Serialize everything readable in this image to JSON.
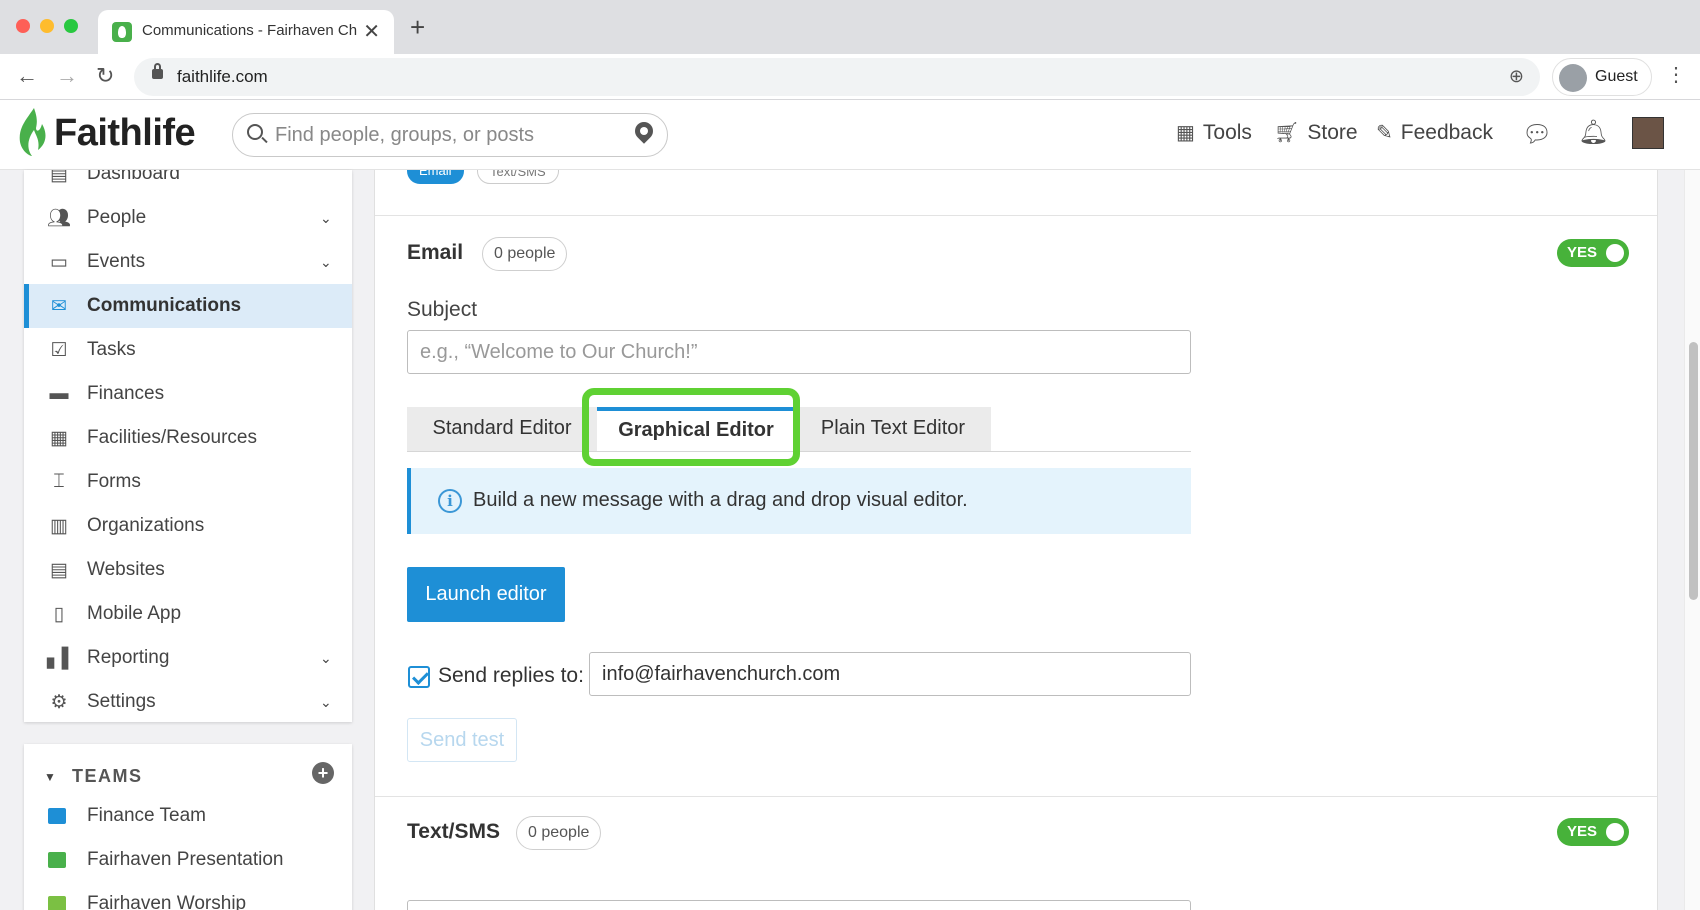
{
  "browser": {
    "tab_title": "Communications - Fairhaven Church",
    "url": "faithlife.com",
    "profile_label": "Guest",
    "icons": [
      "back-icon",
      "forward-icon",
      "reload-icon",
      "lock-icon",
      "zoom-icon",
      "menu-icon"
    ]
  },
  "header": {
    "logo": "Faithlife",
    "search_placeholder": "Find people, groups, or posts",
    "nav": [
      {
        "label": "Tools",
        "icon": "grid-icon"
      },
      {
        "label": "Store",
        "icon": "cart-icon"
      },
      {
        "label": "Feedback",
        "icon": "feedback-icon"
      }
    ]
  },
  "sidebar": {
    "items": [
      {
        "label": "Dashboard",
        "icon": "dashboard-icon",
        "chevron": false
      },
      {
        "label": "People",
        "icon": "people-icon",
        "chevron": true
      },
      {
        "label": "Events",
        "icon": "calendar-icon",
        "chevron": true
      },
      {
        "label": "Communications",
        "icon": "envelope-icon",
        "chevron": false,
        "active": true
      },
      {
        "label": "Tasks",
        "icon": "clipboard-icon",
        "chevron": false
      },
      {
        "label": "Finances",
        "icon": "credit-card-icon",
        "chevron": false
      },
      {
        "label": "Facilities/Resources",
        "icon": "building-icon",
        "chevron": false
      },
      {
        "label": "Forms",
        "icon": "form-icon",
        "chevron": false
      },
      {
        "label": "Organizations",
        "icon": "organization-icon",
        "chevron": false
      },
      {
        "label": "Websites",
        "icon": "website-icon",
        "chevron": false
      },
      {
        "label": "Mobile App",
        "icon": "mobile-icon",
        "chevron": false
      },
      {
        "label": "Reporting",
        "icon": "bar-chart-icon",
        "chevron": true
      },
      {
        "label": "Settings",
        "icon": "gear-icon",
        "chevron": true
      }
    ]
  },
  "teams": {
    "heading": "TEAMS",
    "items": [
      {
        "label": "Finance Team",
        "color": "#1e8fd6"
      },
      {
        "label": "Fairhaven Presentation",
        "color": "#49b04b"
      },
      {
        "label": "Fairhaven Worship",
        "color": "#7bc043"
      }
    ]
  },
  "main": {
    "top_pills": [
      "Email",
      "Text/SMS"
    ],
    "email": {
      "title": "Email",
      "people_count": "0 people",
      "toggle_label": "YES",
      "subject_label": "Subject",
      "subject_placeholder": "e.g., “Welcome to Our Church!”",
      "editor_tabs": [
        "Standard Editor",
        "Graphical Editor",
        "Plain Text Editor"
      ],
      "active_tab": "Graphical Editor",
      "info_text": "Build a new message with a drag and drop visual editor.",
      "launch_label": "Launch editor",
      "replies_label": "Send replies to:",
      "replies_checked": true,
      "replies_value": "info@fairhavenchurch.com",
      "send_test_label": "Send test"
    },
    "sms": {
      "title": "Text/SMS",
      "people_count": "0 people",
      "toggle_label": "YES"
    }
  },
  "colors": {
    "accent": "#1e8fd6",
    "toggle_on": "#47b23a",
    "highlight": "#5fd133",
    "active_bg": "#dcebf8"
  }
}
